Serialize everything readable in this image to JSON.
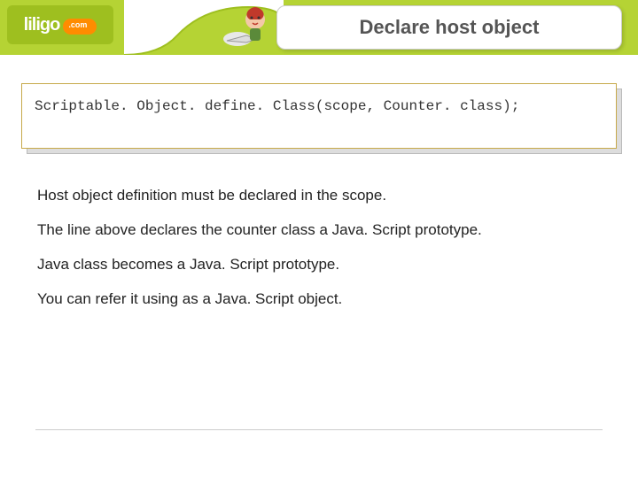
{
  "header": {
    "logo_text": "liligo",
    "title": "Declare host object"
  },
  "code": {
    "line": "Scriptable. Object. define. Class(scope, Counter. class);"
  },
  "body": {
    "p1": "Host object definition must be declared in the scope.",
    "p2": "The line above declares the counter class a Java. Script prototype.",
    "p3": "Java class becomes a Java. Script prototype.",
    "p4": "You can refer it using as a Java. Script object."
  }
}
